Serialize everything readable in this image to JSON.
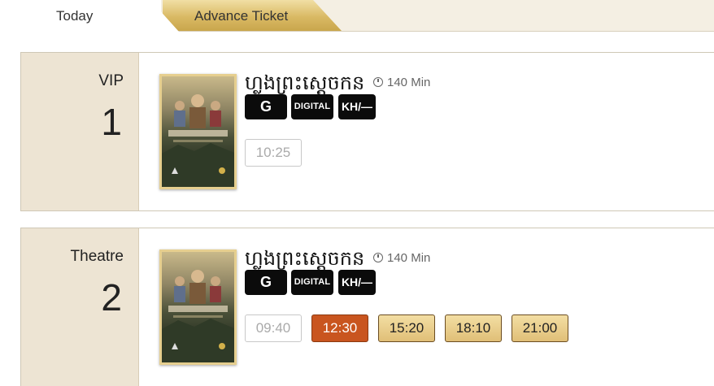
{
  "tabs": [
    {
      "label": "Today"
    },
    {
      "label": "Advance Ticket"
    }
  ],
  "halls": [
    {
      "type": "VIP",
      "number": "1",
      "movie": {
        "title": "ហ្លួងព្រះស្ដេចកន",
        "duration": "140 Min",
        "badges": [
          "G",
          "DIGITAL",
          "KH/—"
        ]
      },
      "showtimes": [
        {
          "time": "10:25",
          "state": "past"
        }
      ]
    },
    {
      "type": "Theatre",
      "number": "2",
      "movie": {
        "title": "ហ្លួងព្រះស្ដេចកន",
        "duration": "140 Min",
        "badges": [
          "G",
          "DIGITAL",
          "KH/—"
        ]
      },
      "showtimes": [
        {
          "time": "09:40",
          "state": "past"
        },
        {
          "time": "12:30",
          "state": "selected"
        },
        {
          "time": "15:20",
          "state": "available"
        },
        {
          "time": "18:10",
          "state": "available"
        },
        {
          "time": "21:00",
          "state": "available"
        }
      ]
    }
  ],
  "colors": {
    "side_bg": "#ede4d3",
    "tab_gold": "#d9b964",
    "selected_time": "#c9551f",
    "available_time": "#e0bf77"
  }
}
